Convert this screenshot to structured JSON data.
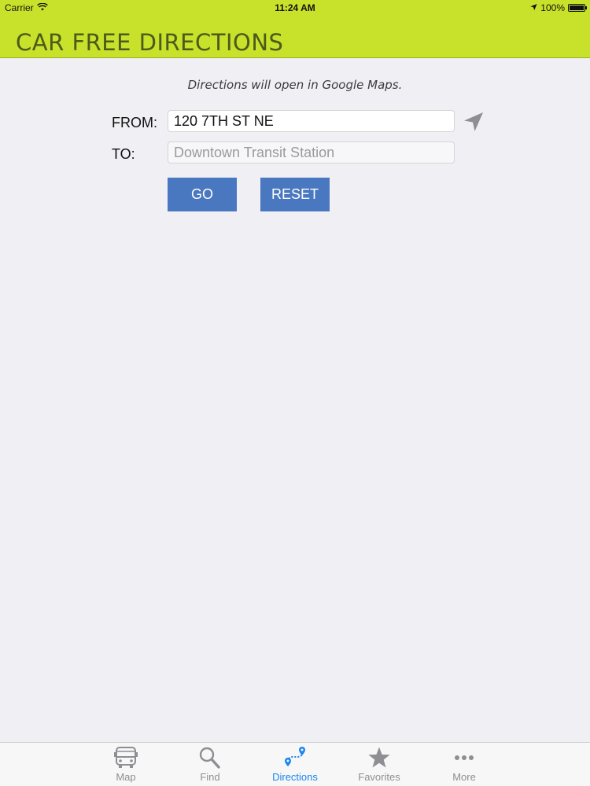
{
  "status_bar": {
    "carrier": "Carrier",
    "time": "11:24 AM",
    "battery": "100%"
  },
  "header": {
    "title": "CAR FREE DIRECTIONS",
    "background_color": "#c8e12a"
  },
  "notice": "Directions will open in Google Maps.",
  "form": {
    "from_label": "FROM:",
    "from_value": "120 7TH ST NE",
    "to_label": "TO:",
    "to_placeholder": "Downtown Transit Station",
    "go_label": "GO",
    "reset_label": "RESET",
    "button_color": "#4a78c0"
  },
  "tabs": [
    {
      "label": "Map",
      "icon": "bus-icon",
      "active": false
    },
    {
      "label": "Find",
      "icon": "search-icon",
      "active": false
    },
    {
      "label": "Directions",
      "icon": "directions-route-icon",
      "active": true
    },
    {
      "label": "Favorites",
      "icon": "star-icon",
      "active": false
    },
    {
      "label": "More",
      "icon": "more-dots-icon",
      "active": false
    }
  ],
  "active_tab_color": "#1a86f0"
}
